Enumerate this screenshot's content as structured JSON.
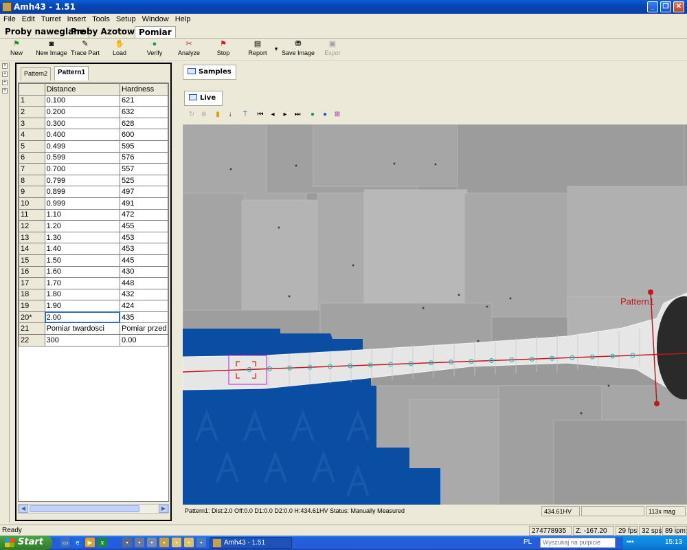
{
  "window": {
    "title": "Amh43 - 1.51"
  },
  "menu": [
    "File",
    "Edit",
    "Turret",
    "Insert",
    "Tools",
    "Setup",
    "Window",
    "Help"
  ],
  "perspective_tabs": [
    "Proby naweglane",
    "Proby Azotowane",
    "Pomiar"
  ],
  "toolbar": {
    "new": "New",
    "new_image": "New Image",
    "trace_part": "Trace Part",
    "load": "Load",
    "verify": "Verify",
    "analyze": "Analyze",
    "stop": "Stop",
    "report": "Report",
    "save_image": "Save Image",
    "export": "Expor"
  },
  "left_tabs": [
    "Pattern2",
    "Pattern1"
  ],
  "table": {
    "columns": [
      "",
      "Distance",
      "Hardness"
    ],
    "rows": [
      [
        "1",
        "0.100",
        "621"
      ],
      [
        "2",
        "0.200",
        "632"
      ],
      [
        "3",
        "0.300",
        "628"
      ],
      [
        "4",
        "0.400",
        "600"
      ],
      [
        "5",
        "0.499",
        "595"
      ],
      [
        "6",
        "0.599",
        "576"
      ],
      [
        "7",
        "0.700",
        "557"
      ],
      [
        "8",
        "0.799",
        "525"
      ],
      [
        "9",
        "0.899",
        "497"
      ],
      [
        "10",
        "0.999",
        "491"
      ],
      [
        "11",
        "1.10",
        "472"
      ],
      [
        "12",
        "1.20",
        "455"
      ],
      [
        "13",
        "1.30",
        "453"
      ],
      [
        "14",
        "1.40",
        "453"
      ],
      [
        "15",
        "1.50",
        "445"
      ],
      [
        "16",
        "1.60",
        "430"
      ],
      [
        "17",
        "1.70",
        "448"
      ],
      [
        "18",
        "1.80",
        "432"
      ],
      [
        "19",
        "1.90",
        "424"
      ],
      [
        "20*",
        "2.00",
        "435"
      ],
      [
        "21",
        "Pomiar twardosci",
        "Pomiar przed"
      ],
      [
        "22",
        "300",
        "0.00"
      ]
    ]
  },
  "right_tabs": {
    "samples": "Samples",
    "live": "Live"
  },
  "image": {
    "pattern_label": "Pattern1",
    "accent_line": "#c0161c",
    "mount_color": "#0a4ea3"
  },
  "view_status": {
    "info": "Pattern1: Dist:2.0 Off:0.0 D1:0.0 D2:0.0 H:434.61HV Status: Manually Measured",
    "hv": "434.61HV",
    "mag": "113x mag"
  },
  "app_status": {
    "ready": "Ready",
    "coord": "274778935",
    "z": "Z: -167.20",
    "fps": "29 fps",
    "sps": "32 sps",
    "ipm": "89 ipm"
  },
  "taskbar": {
    "start": "Start",
    "app": "Amh43 - 1.51",
    "lang": "PL",
    "search_placeholder": "Wyszukaj na pulpicie",
    "clock": "15:13"
  }
}
